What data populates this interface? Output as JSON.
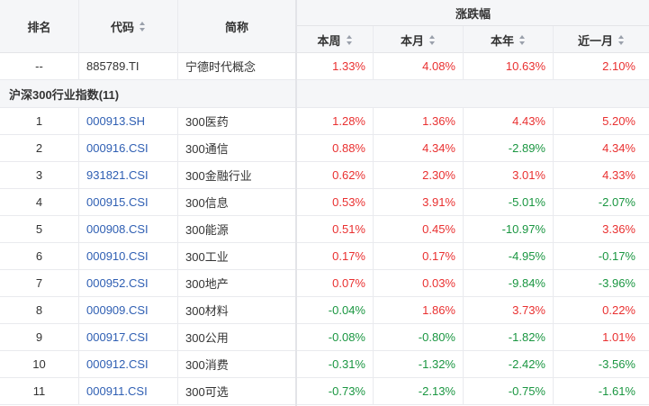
{
  "header": {
    "rank": "排名",
    "code": "代码",
    "name": "简称",
    "group": "涨跌幅",
    "week": "本周",
    "month": "本月",
    "year": "本年",
    "recent_month": "近一月"
  },
  "concept_row": {
    "rank": "--",
    "code": "885789.TI",
    "name": "宁德时代概念",
    "week": "1.33%",
    "month": "4.08%",
    "year": "10.63%",
    "recent_month": "2.10%"
  },
  "section_title": "沪深300行业指数(11)",
  "rows": [
    {
      "rank": "1",
      "code": "000913.SH",
      "name": "300医药",
      "week": "1.28%",
      "month": "1.36%",
      "year": "4.43%",
      "recent_month": "5.20%"
    },
    {
      "rank": "2",
      "code": "000916.CSI",
      "name": "300通信",
      "week": "0.88%",
      "month": "4.34%",
      "year": "-2.89%",
      "recent_month": "4.34%"
    },
    {
      "rank": "3",
      "code": "931821.CSI",
      "name": "300金融行业",
      "week": "0.62%",
      "month": "2.30%",
      "year": "3.01%",
      "recent_month": "4.33%"
    },
    {
      "rank": "4",
      "code": "000915.CSI",
      "name": "300信息",
      "week": "0.53%",
      "month": "3.91%",
      "year": "-5.01%",
      "recent_month": "-2.07%"
    },
    {
      "rank": "5",
      "code": "000908.CSI",
      "name": "300能源",
      "week": "0.51%",
      "month": "0.45%",
      "year": "-10.97%",
      "recent_month": "3.36%"
    },
    {
      "rank": "6",
      "code": "000910.CSI",
      "name": "300工业",
      "week": "0.17%",
      "month": "0.17%",
      "year": "-4.95%",
      "recent_month": "-0.17%"
    },
    {
      "rank": "7",
      "code": "000952.CSI",
      "name": "300地产",
      "week": "0.07%",
      "month": "0.03%",
      "year": "-9.84%",
      "recent_month": "-3.96%"
    },
    {
      "rank": "8",
      "code": "000909.CSI",
      "name": "300材料",
      "week": "-0.04%",
      "month": "1.86%",
      "year": "3.73%",
      "recent_month": "0.22%"
    },
    {
      "rank": "9",
      "code": "000917.CSI",
      "name": "300公用",
      "week": "-0.08%",
      "month": "-0.80%",
      "year": "-1.82%",
      "recent_month": "1.01%"
    },
    {
      "rank": "10",
      "code": "000912.CSI",
      "name": "300消费",
      "week": "-0.31%",
      "month": "-1.32%",
      "year": "-2.42%",
      "recent_month": "-3.56%"
    },
    {
      "rank": "11",
      "code": "000911.CSI",
      "name": "300可选",
      "week": "-0.73%",
      "month": "-2.13%",
      "year": "-0.75%",
      "recent_month": "-1.61%"
    }
  ],
  "colors": {
    "up": "#e93030",
    "down": "#1a9641",
    "link": "#2f5fb3",
    "header_bg": "#f5f6f8"
  }
}
